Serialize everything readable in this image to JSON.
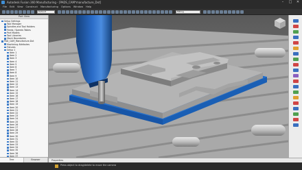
{
  "window": {
    "title": "Autodesk Fusion 360 Manufacturing - [PADS_CAM*manufacture_Dxt]"
  },
  "menubar": {
    "items": [
      "File",
      "Edit",
      "View",
      "Construct",
      "Manufacturing",
      "Options",
      "Window",
      "Help"
    ]
  },
  "toolbar": {
    "combo1_value": "Default",
    "combo2_value": "Milling"
  },
  "panel": {
    "title": "Part View",
    "tree": [
      {
        "label": "Setup Settings",
        "indent": 0
      },
      {
        "label": "Tool Manager",
        "indent": 1
      },
      {
        "label": "Spindles and Tool Holders",
        "indent": 1
      },
      {
        "label": "Feeds / Speeds Tables",
        "indent": 1
      },
      {
        "label": "Part Models",
        "indent": 1
      },
      {
        "label": "Tool Libraries",
        "indent": 1
      },
      {
        "label": "Stock Boundaries",
        "indent": 1
      },
      {
        "label": "PAD_CAM_Manufacture.Dxt",
        "indent": 0
      },
      {
        "label": "Machining Attributes",
        "indent": 1
      },
      {
        "label": "Fixtures",
        "indent": 1
      },
      {
        "label": "Setup 1",
        "indent": 1
      },
      {
        "label": "Item 1",
        "indent": 2
      },
      {
        "label": "Item 2",
        "indent": 2
      },
      {
        "label": "Item 3",
        "indent": 2
      },
      {
        "label": "Item 4",
        "indent": 2
      },
      {
        "label": "Item 5",
        "indent": 2
      },
      {
        "label": "Item 6",
        "indent": 2
      },
      {
        "label": "Item 7",
        "indent": 2
      },
      {
        "label": "Item 8",
        "indent": 2
      },
      {
        "label": "Item 9",
        "indent": 2
      },
      {
        "label": "Item 10",
        "indent": 2
      },
      {
        "label": "Item 11",
        "indent": 2
      },
      {
        "label": "Item 12",
        "indent": 2
      },
      {
        "label": "Item 13",
        "indent": 2
      },
      {
        "label": "Item 14",
        "indent": 2
      },
      {
        "label": "Item 15",
        "indent": 2
      },
      {
        "label": "Item 16",
        "indent": 2
      },
      {
        "label": "Item 17",
        "indent": 2
      },
      {
        "label": "Item 18",
        "indent": 2
      },
      {
        "label": "Item 19",
        "indent": 2
      },
      {
        "label": "Item 20",
        "indent": 2
      },
      {
        "label": "Item 21",
        "indent": 2
      },
      {
        "label": "Item 22",
        "indent": 2
      },
      {
        "label": "Item 23",
        "indent": 2
      },
      {
        "label": "Item 24",
        "indent": 2
      },
      {
        "label": "Item 25",
        "indent": 2
      },
      {
        "label": "Item 26",
        "indent": 2
      },
      {
        "label": "Item 27",
        "indent": 2
      },
      {
        "label": "Item 28",
        "indent": 2
      },
      {
        "label": "Item 29",
        "indent": 2
      },
      {
        "label": "Item 30",
        "indent": 2
      },
      {
        "label": "Item 31",
        "indent": 2
      },
      {
        "label": "Item 32",
        "indent": 2
      },
      {
        "label": "Item 33",
        "indent": 2
      },
      {
        "label": "Item 34",
        "indent": 2
      },
      {
        "label": "Item 35",
        "indent": 2
      },
      {
        "label": "Item 36",
        "indent": 2
      },
      {
        "label": "Item 37",
        "indent": 2
      }
    ],
    "tabs": [
      "Tree",
      "Browser"
    ]
  },
  "viewport": {
    "bottom_label": "Properties"
  },
  "status": {
    "message": "Press object to drag/delete to move the camera"
  },
  "colors": {
    "accent": "#1f6fd1",
    "tool_blue": "#1f5fb0",
    "part_grey": "#9a9a9a",
    "table_grey": "#b8b8b8"
  },
  "icons": {
    "viewcube": "viewcube-icon",
    "app": "app-icon"
  }
}
